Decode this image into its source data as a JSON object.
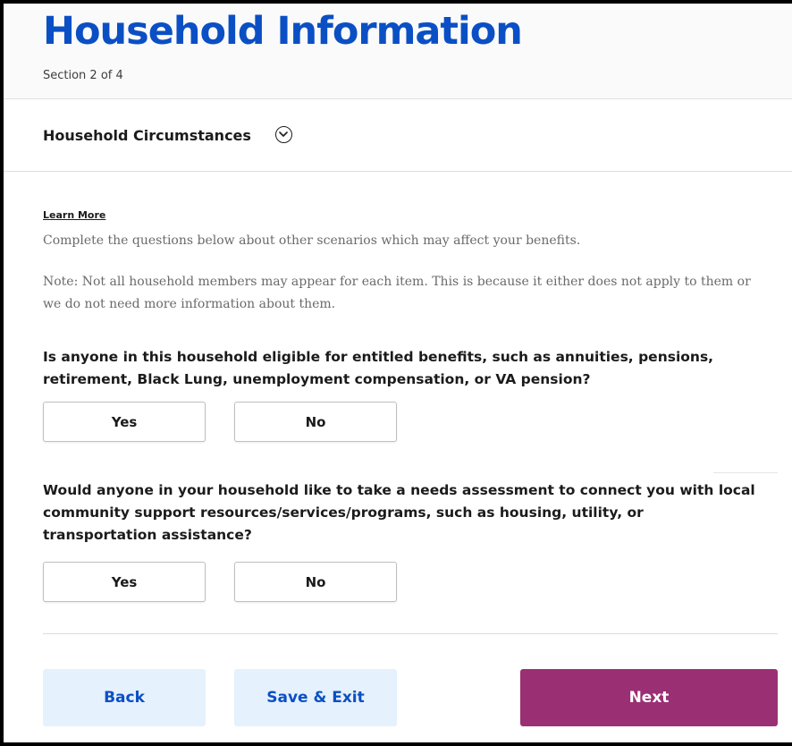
{
  "header": {
    "title": "Household Information",
    "section_progress": "Section 2 of 4"
  },
  "subsection": {
    "title": "Household Circumstances",
    "toggle_icon": "chevron-down-circle-icon"
  },
  "intro": {
    "learn_more": "Learn More",
    "instructions": "Complete the questions below about other scenarios which may affect your benefits.",
    "note": "Note: Not all household members may appear for each item. This is because it either does not apply to them or we do not need more information about them."
  },
  "questions": [
    {
      "text": "Is anyone in this household eligible for entitled benefits, such as annuities, pensions, retirement, Black Lung, unemployment compensation, or VA pension?",
      "yes_label": "Yes",
      "no_label": "No"
    },
    {
      "text": "Would anyone in your household like to take a needs assessment to connect you with local community support resources/services/programs, such as housing, utility, or transportation assistance?",
      "yes_label": "Yes",
      "no_label": "No"
    }
  ],
  "footer": {
    "back_label": "Back",
    "save_exit_label": "Save & Exit",
    "next_label": "Next"
  },
  "colors": {
    "title_blue": "#0b4fc4",
    "secondary_button_bg": "#e5f1fd",
    "primary_button_bg": "#9b2f74"
  }
}
